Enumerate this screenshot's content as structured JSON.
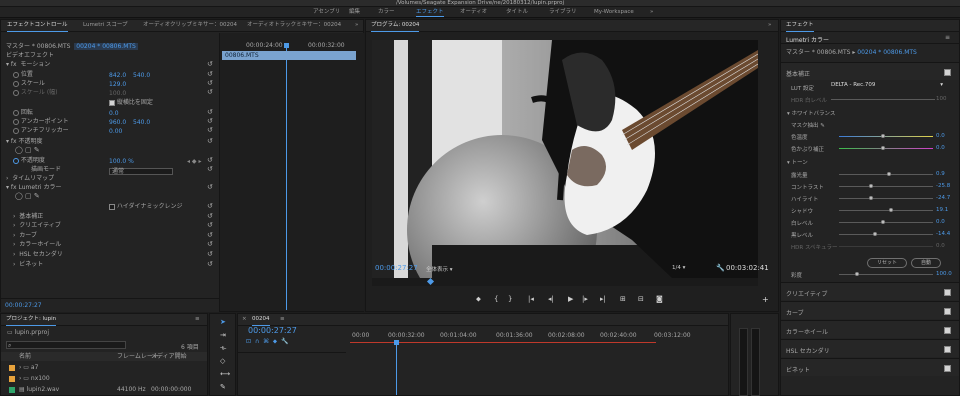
{
  "window": {
    "title": "/Volumes/Seagate Expansion Drive/ne/20180312/lupin.prproj"
  },
  "workspaces": [
    {
      "label": "アセンブリ",
      "active": false
    },
    {
      "label": "編集",
      "active": false
    },
    {
      "label": "カラー",
      "active": false
    },
    {
      "label": "エフェクト",
      "active": true
    },
    {
      "label": "オーディオ",
      "active": false
    },
    {
      "label": "タイトル",
      "active": false
    },
    {
      "label": "ライブラリ",
      "active": false
    },
    {
      "label": "My-Workspace",
      "active": false
    }
  ],
  "effect_controls": {
    "tabs": [
      "エフェクトコントロール",
      "Lumetri スコープ",
      "オーディオクリップミキサー：00204",
      "オーディオトラックミキサー：00204"
    ],
    "master": "マスター * 00806.MTS",
    "clip": "00204 * 00806.MTS",
    "video_effects": "ビデオエフェクト",
    "timecode_left": "00:00:24:00",
    "timecode_right": "00:00:32:00",
    "clip_name": "00806.MTS",
    "motion": "モーション",
    "position": {
      "label": "位置",
      "x": "842.0",
      "y": "540.0"
    },
    "scale": {
      "label": "スケール",
      "value": "129.0"
    },
    "scale_w": {
      "label": "スケール (幅)",
      "value": "100.0"
    },
    "uniform": "縦横比を固定",
    "rotation": {
      "label": "回転",
      "value": "0.0"
    },
    "anchor": {
      "label": "アンカーポイント",
      "x": "960.0",
      "y": "540.0"
    },
    "flicker": {
      "label": "アンチフリッカー",
      "value": "0.00"
    },
    "opacity_group": "不透明度",
    "opacity": {
      "label": "不透明度",
      "value": "100.0 %"
    },
    "blend": {
      "label": "描画モード",
      "value": "通常"
    },
    "timeremap": "タイムリマップ",
    "lumetri": "Lumetri カラー",
    "hdr": "ハイダイナミックレンジ",
    "sections": [
      "基本補正",
      "クリエイティブ",
      "カーブ",
      "カラーホイール",
      "HSL セカンダリ",
      "ビネット"
    ],
    "bottom_timecode": "00:00:27:27"
  },
  "program": {
    "title": "プログラム: 00204",
    "timecode": "00:00:27:27",
    "fit": "全体表示",
    "ratio": "1/4",
    "duration": "00:03:02:41"
  },
  "project": {
    "tab": "プロジェクト: lupin",
    "file": "lupin.prproj",
    "count": "6 項目",
    "columns": [
      "名前",
      "フレームレート",
      "メディア開始"
    ],
    "items": [
      {
        "name": "a7",
        "rate": "",
        "start": "",
        "color": "#e8a33c"
      },
      {
        "name": "nx100",
        "rate": "",
        "start": "",
        "color": "#e8a33c"
      },
      {
        "name": "lupin2.wav",
        "rate": "44100 Hz",
        "start": "00:00:00:000",
        "color": "#2fa56b"
      }
    ]
  },
  "timeline": {
    "tab": "00204",
    "timecode": "00:00:27:27",
    "ruler": [
      "00:00",
      "00:00:32:00",
      "00:01:04:00",
      "00:01:36:00",
      "00:02:08:00",
      "00:02:40:00",
      "00:03:12:00"
    ]
  },
  "lumetri_panel": {
    "tab": "エフェクト",
    "title": "Lumetri カラー",
    "master": "マスター * 00806.MTS",
    "clip": "00204 * 00806.MTS",
    "basic": "基本補正",
    "lut_label": "LUT 設定",
    "lut_value": "DELTA - Rec.709",
    "hdr_label": "HDR 白レベル",
    "hdr_value": "100",
    "wb": "ホワイトバランス",
    "selector": "マスク抽出",
    "temp": {
      "label": "色温度",
      "value": "0.0"
    },
    "tint": {
      "label": "色かぶり補正",
      "value": "0.0"
    },
    "tone": "トーン",
    "exposure": {
      "label": "露光量",
      "value": "0.9"
    },
    "contrast": {
      "label": "コントラスト",
      "value": "-25.8"
    },
    "highlight": {
      "label": "ハイライト",
      "value": "-24.7"
    },
    "shadow": {
      "label": "シャドウ",
      "value": "19.1"
    },
    "white": {
      "label": "白レベル",
      "value": "0.0"
    },
    "black": {
      "label": "黒レベル",
      "value": "-14.4"
    },
    "hdr_spec": {
      "label": "HDR スペキュラー",
      "value": "0.0"
    },
    "reset_btn": "リセット",
    "auto_btn": "自動",
    "saturation": {
      "label": "彩度",
      "value": "100.0"
    },
    "sections": [
      "クリエイティブ",
      "カーブ",
      "カラーホイール",
      "HSL セカンダリ",
      "ビネット"
    ]
  }
}
